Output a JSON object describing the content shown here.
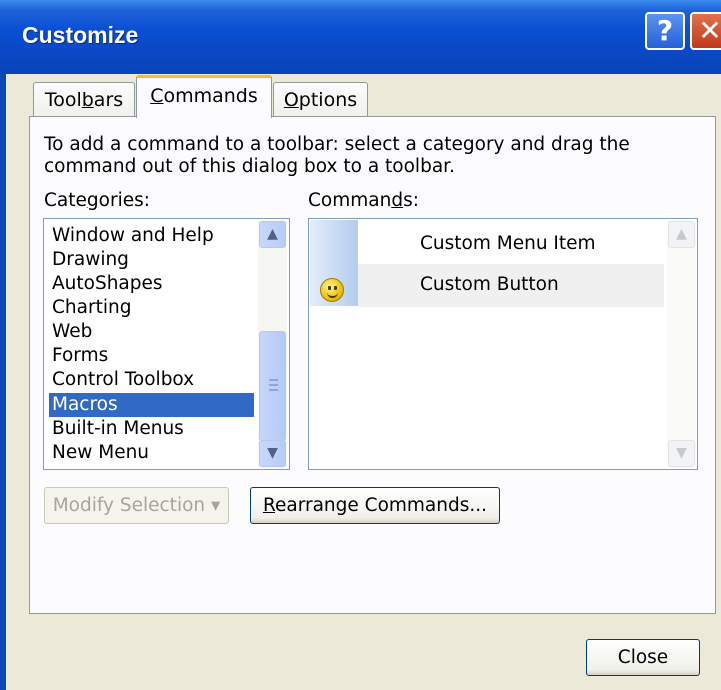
{
  "window": {
    "title": "Customize",
    "help_glyph": "?",
    "close_glyph": "✕"
  },
  "tabs": [
    {
      "label_pre": "Tool",
      "label_u": "b",
      "label_post": "ars"
    },
    {
      "label_pre": "",
      "label_u": "C",
      "label_post": "ommands"
    },
    {
      "label_pre": "",
      "label_u": "O",
      "label_post": "ptions"
    }
  ],
  "instructions": "To add a command to a toolbar: select a category and drag the command out of this dialog box to a toolbar.",
  "categories": {
    "label_pre": "Cate",
    "label_u": "g",
    "label_post": "ories:",
    "items": [
      "Window and Help",
      "Drawing",
      "AutoShapes",
      "Charting",
      "Web",
      "Forms",
      "Control Toolbox",
      "Macros",
      "Built-in Menus",
      "New Menu"
    ],
    "selected": "Macros"
  },
  "commands": {
    "label_pre": "Comman",
    "label_u": "d",
    "label_post": "s:",
    "items": [
      {
        "label": "Custom Menu Item",
        "icon": "none"
      },
      {
        "label": "Custom Button",
        "icon": "smiley-icon"
      }
    ]
  },
  "buttons": {
    "modify": "Modify Selection",
    "modify_arrow": "▾",
    "rearrange_pre": "",
    "rearrange_u": "R",
    "rearrange_post": "earrange Commands...",
    "close": "Close"
  },
  "scroll_arrows": {
    "up": "▲",
    "down": "▼"
  },
  "colors": {
    "title_bar": "#0a4fd4",
    "selection": "#316ac5",
    "active_tab_accent": "#f9b53e",
    "dialog_face": "#ece9d8"
  }
}
